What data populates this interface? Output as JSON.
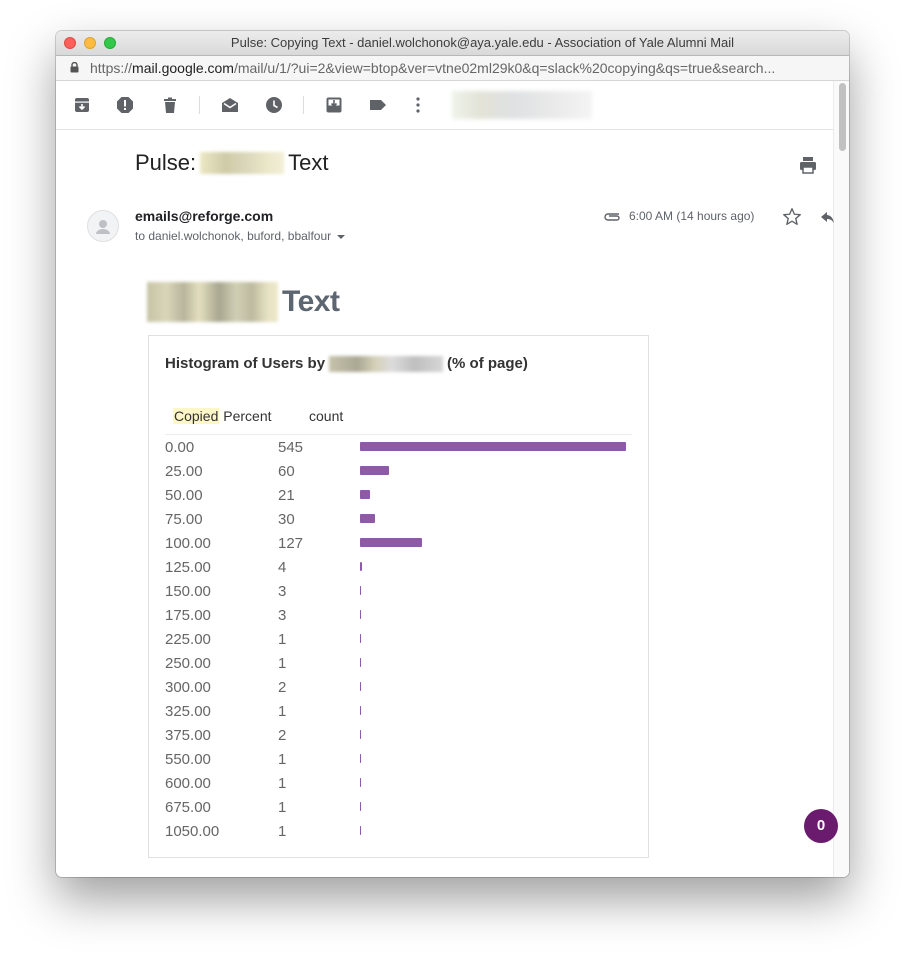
{
  "window": {
    "title": "Pulse: Copying Text - daniel.wolchonok@aya.yale.edu - Association of Yale Alumni Mail"
  },
  "urlbar": {
    "scheme": "https://",
    "host": "mail.google.com",
    "path": "/mail/u/1/?ui=2&view=btop&ver=vtne02ml29k0&q=slack%20copying&qs=true&search..."
  },
  "toolbar": {
    "icons": [
      "archive-icon",
      "report-spam-icon",
      "delete-icon",
      "mark-unread-icon",
      "snooze-icon",
      "move-to-icon",
      "label-icon",
      "more-icon"
    ]
  },
  "email": {
    "subject_prefix": "Pulse:",
    "subject_suffix": "Text",
    "sender": "emails@reforge.com",
    "recipients": "to daniel.wolchonok, buford, bbalfour",
    "time": "6:00 AM (14 hours ago)"
  },
  "report": {
    "title_suffix": "Text",
    "card_title_prefix": "Histogram of Users by",
    "card_title_suffix": "(% of page)",
    "col_highlight": "Copied",
    "col_percent": "Percent",
    "col_count": "count",
    "accent_color": "#8e59a9"
  },
  "chart_data": {
    "type": "bar",
    "orientation": "horizontal",
    "xlabel": "count",
    "categories": [
      "0.00",
      "25.00",
      "50.00",
      "75.00",
      "100.00",
      "125.00",
      "150.00",
      "175.00",
      "225.00",
      "250.00",
      "300.00",
      "325.00",
      "375.00",
      "550.00",
      "600.00",
      "675.00",
      "1050.00"
    ],
    "values": [
      545,
      60,
      21,
      30,
      127,
      4,
      3,
      3,
      1,
      1,
      2,
      1,
      2,
      1,
      1,
      1,
      1
    ]
  },
  "fab": {
    "label": "0"
  }
}
